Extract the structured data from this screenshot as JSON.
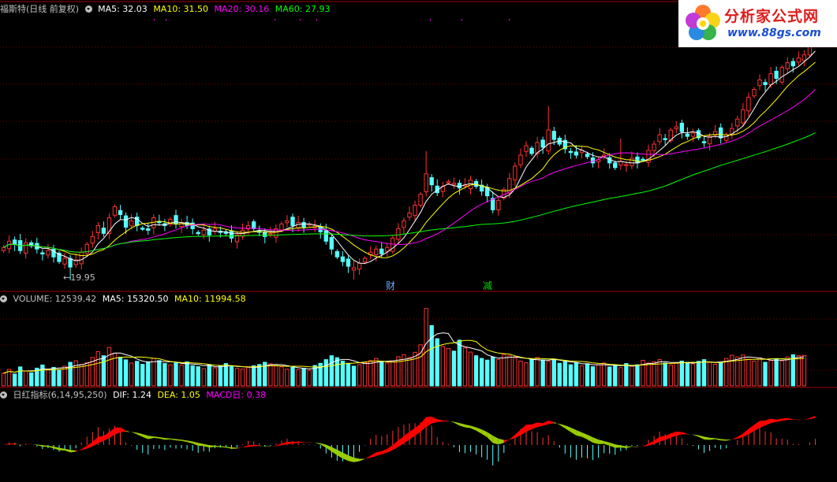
{
  "price_header": {
    "title": "福斯特(日线 前复权)",
    "ma5": "MA5: 32.03",
    "ma10": "MA10: 31.50",
    "ma20": "MA20: 30.16",
    "ma60": "MA60: 27.93"
  },
  "volume_header": {
    "title": "VOLUME: 12539.42",
    "ma5": "MA5: 15320.50",
    "ma10": "MA10: 11994.58"
  },
  "macd_header": {
    "title": "日红指标(6,14,95,250)",
    "dif": "DIF: 1.24",
    "dea": "DEA: 1.05",
    "macd": "MACD日: 0.38"
  },
  "annotations": {
    "low_label": "19.95",
    "event_1": "财",
    "event_2": "减"
  },
  "logo": {
    "title": "分析家公式网",
    "url": "www.88gs.com"
  },
  "colors": {
    "up": "#ff3232",
    "down": "#54ffff",
    "ma5": "#ffffff",
    "ma10": "#ffff00",
    "ma20": "#ff00ff",
    "ma60": "#00ff00",
    "macd_red": "#ff0000",
    "macd_green": "#99cc00"
  },
  "chart_data": {
    "type": "candlestick",
    "closes": [
      21.2,
      21.6,
      21.4,
      21.0,
      21.5,
      21.3,
      21.1,
      20.8,
      21.0,
      20.6,
      20.3,
      20.5,
      19.95,
      20.4,
      20.9,
      21.4,
      21.9,
      22.6,
      22.1,
      23.1,
      23.8,
      23.3,
      22.5,
      22.9,
      22.6,
      22.4,
      22.3,
      23.1,
      22.8,
      22.6,
      23.0,
      22.7,
      22.8,
      22.6,
      22.4,
      22.1,
      22.3,
      22.0,
      22.4,
      22.2,
      22.1,
      21.8,
      22.0,
      22.3,
      22.6,
      22.4,
      22.2,
      21.9,
      22.1,
      22.4,
      22.7,
      22.9,
      22.6,
      22.8,
      22.5,
      22.7,
      22.6,
      22.2,
      21.6,
      21.1,
      20.6,
      20.3,
      20.0,
      19.9,
      20.2,
      20.5,
      20.9,
      21.1,
      20.8,
      21.2,
      21.8,
      22.4,
      22.9,
      23.4,
      23.9,
      24.6,
      25.9,
      25.2,
      24.7,
      25.1,
      25.4,
      25.3,
      25.0,
      25.2,
      25.5,
      25.1,
      24.8,
      24.5,
      23.6,
      24.2,
      24.9,
      25.6,
      26.4,
      27.1,
      27.7,
      27.2,
      27.9,
      27.6,
      28.7,
      28.1,
      27.8,
      27.5,
      27.3,
      27.1,
      27.4,
      27.0,
      26.6,
      26.8,
      27.1,
      26.6,
      26.3,
      26.7,
      26.5,
      26.9,
      26.6,
      26.8,
      27.4,
      27.8,
      28.4,
      28.1,
      28.7,
      28.9,
      28.6,
      28.3,
      28.5,
      28.2,
      27.9,
      28.3,
      28.6,
      28.2,
      28.4,
      28.8,
      29.4,
      30.0,
      30.8,
      31.3,
      31.9,
      31.6,
      32.3,
      32.0,
      32.7,
      33.0,
      32.8,
      33.3,
      33.5,
      34.2,
      34.9
    ],
    "volumes": [
      5200,
      6800,
      4900,
      7800,
      6100,
      5400,
      7300,
      8600,
      6900,
      7600,
      6400,
      8100,
      9700,
      10300,
      8800,
      9600,
      11700,
      14100,
      12400,
      15800,
      13400,
      11800,
      10700,
      9400,
      10100,
      8900,
      9900,
      11300,
      10400,
      9200,
      8700,
      9400,
      8600,
      9900,
      8300,
      7900,
      7100,
      8800,
      7400,
      8100,
      9200,
      8000,
      7200,
      6900,
      7600,
      8300,
      8800,
      9700,
      9100,
      8200,
      7900,
      6900,
      7600,
      6700,
      7200,
      6400,
      8400,
      9300,
      10800,
      12400,
      11600,
      10200,
      9300,
      8100,
      8800,
      9600,
      10400,
      11300,
      10100,
      9400,
      10300,
      12000,
      12800,
      11700,
      13800,
      16900,
      31800,
      24800,
      19400,
      16200,
      15400,
      14300,
      18800,
      15600,
      13900,
      12400,
      11300,
      10600,
      11800,
      10900,
      13000,
      12400,
      11600,
      10200,
      9500,
      10900,
      11700,
      10700,
      10200,
      11000,
      9300,
      9900,
      8700,
      9500,
      8300,
      9100,
      7900,
      8700,
      9400,
      7800,
      8400,
      7500,
      9200,
      8100,
      8700,
      10500,
      9400,
      9900,
      10800,
      9400,
      8600,
      9300,
      10200,
      9700,
      9100,
      10100,
      10800,
      9700,
      8900,
      9800,
      11300,
      12600,
      11900,
      12700,
      11000,
      10200,
      11500,
      9700,
      10500,
      11100,
      10300,
      11900,
      12800,
      12400,
      12539
    ]
  }
}
